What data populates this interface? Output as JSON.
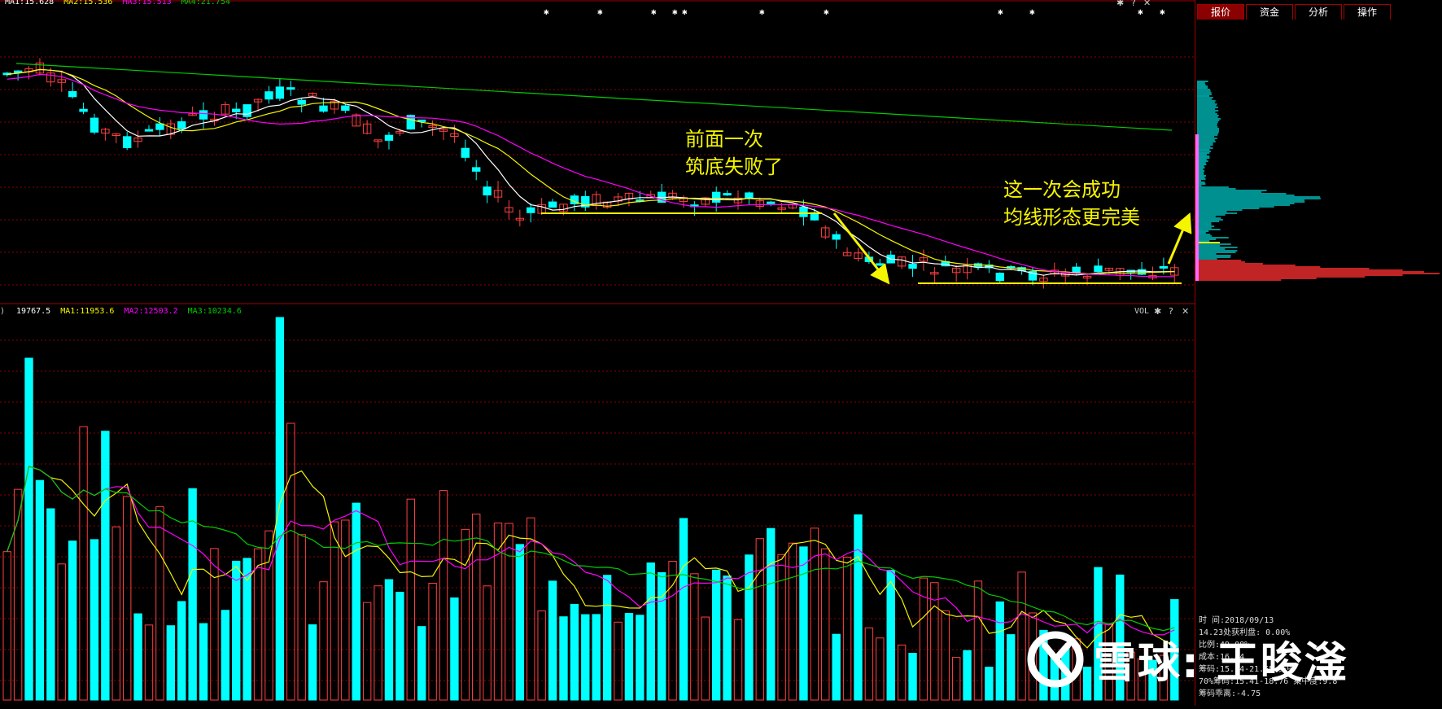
{
  "price_legend": {
    "ma1": "MA1:15.628",
    "ma2": "MA2:15.536",
    "ma3": "MA3:15.513",
    "ma4": "MA4:21.754"
  },
  "volume_legend": {
    "paren": ")",
    "vol": "19767.5",
    "ma1": "MA1:11953.6",
    "ma2": "MA2:12503.2",
    "ma3": "MA3:10234.6"
  },
  "vol_label": "VOL",
  "annotations": {
    "first_line1": "前面一次",
    "first_line2": "筑底失败了",
    "second_line1": "这一次会成功",
    "second_line2": "均线形态更完美"
  },
  "tabs": [
    "报价",
    "资金",
    "分析",
    "操作"
  ],
  "chip_info": {
    "time": "时      间:2018/09/13",
    "profit": "14.23处获利盘: 0.00%",
    "ratio": "  比例:49.08%",
    "cost": "  成本:16.84",
    "band90": "  筹码:15.24-21.55 集中",
    "band70": "70%筹码:15.41-18.76 集中度:9.8",
    "deviation": "筹码乖离:-4.75"
  },
  "watermark": "雪球: 王晙滏",
  "colors": {
    "up": "#ff4040",
    "down": "#00ffff",
    "ma_white": "#ffffff",
    "ma_yellow": "#f5f500",
    "ma_magenta": "#ff00ff",
    "ma_green": "#00cc00",
    "grid": "#8b0000"
  }
}
